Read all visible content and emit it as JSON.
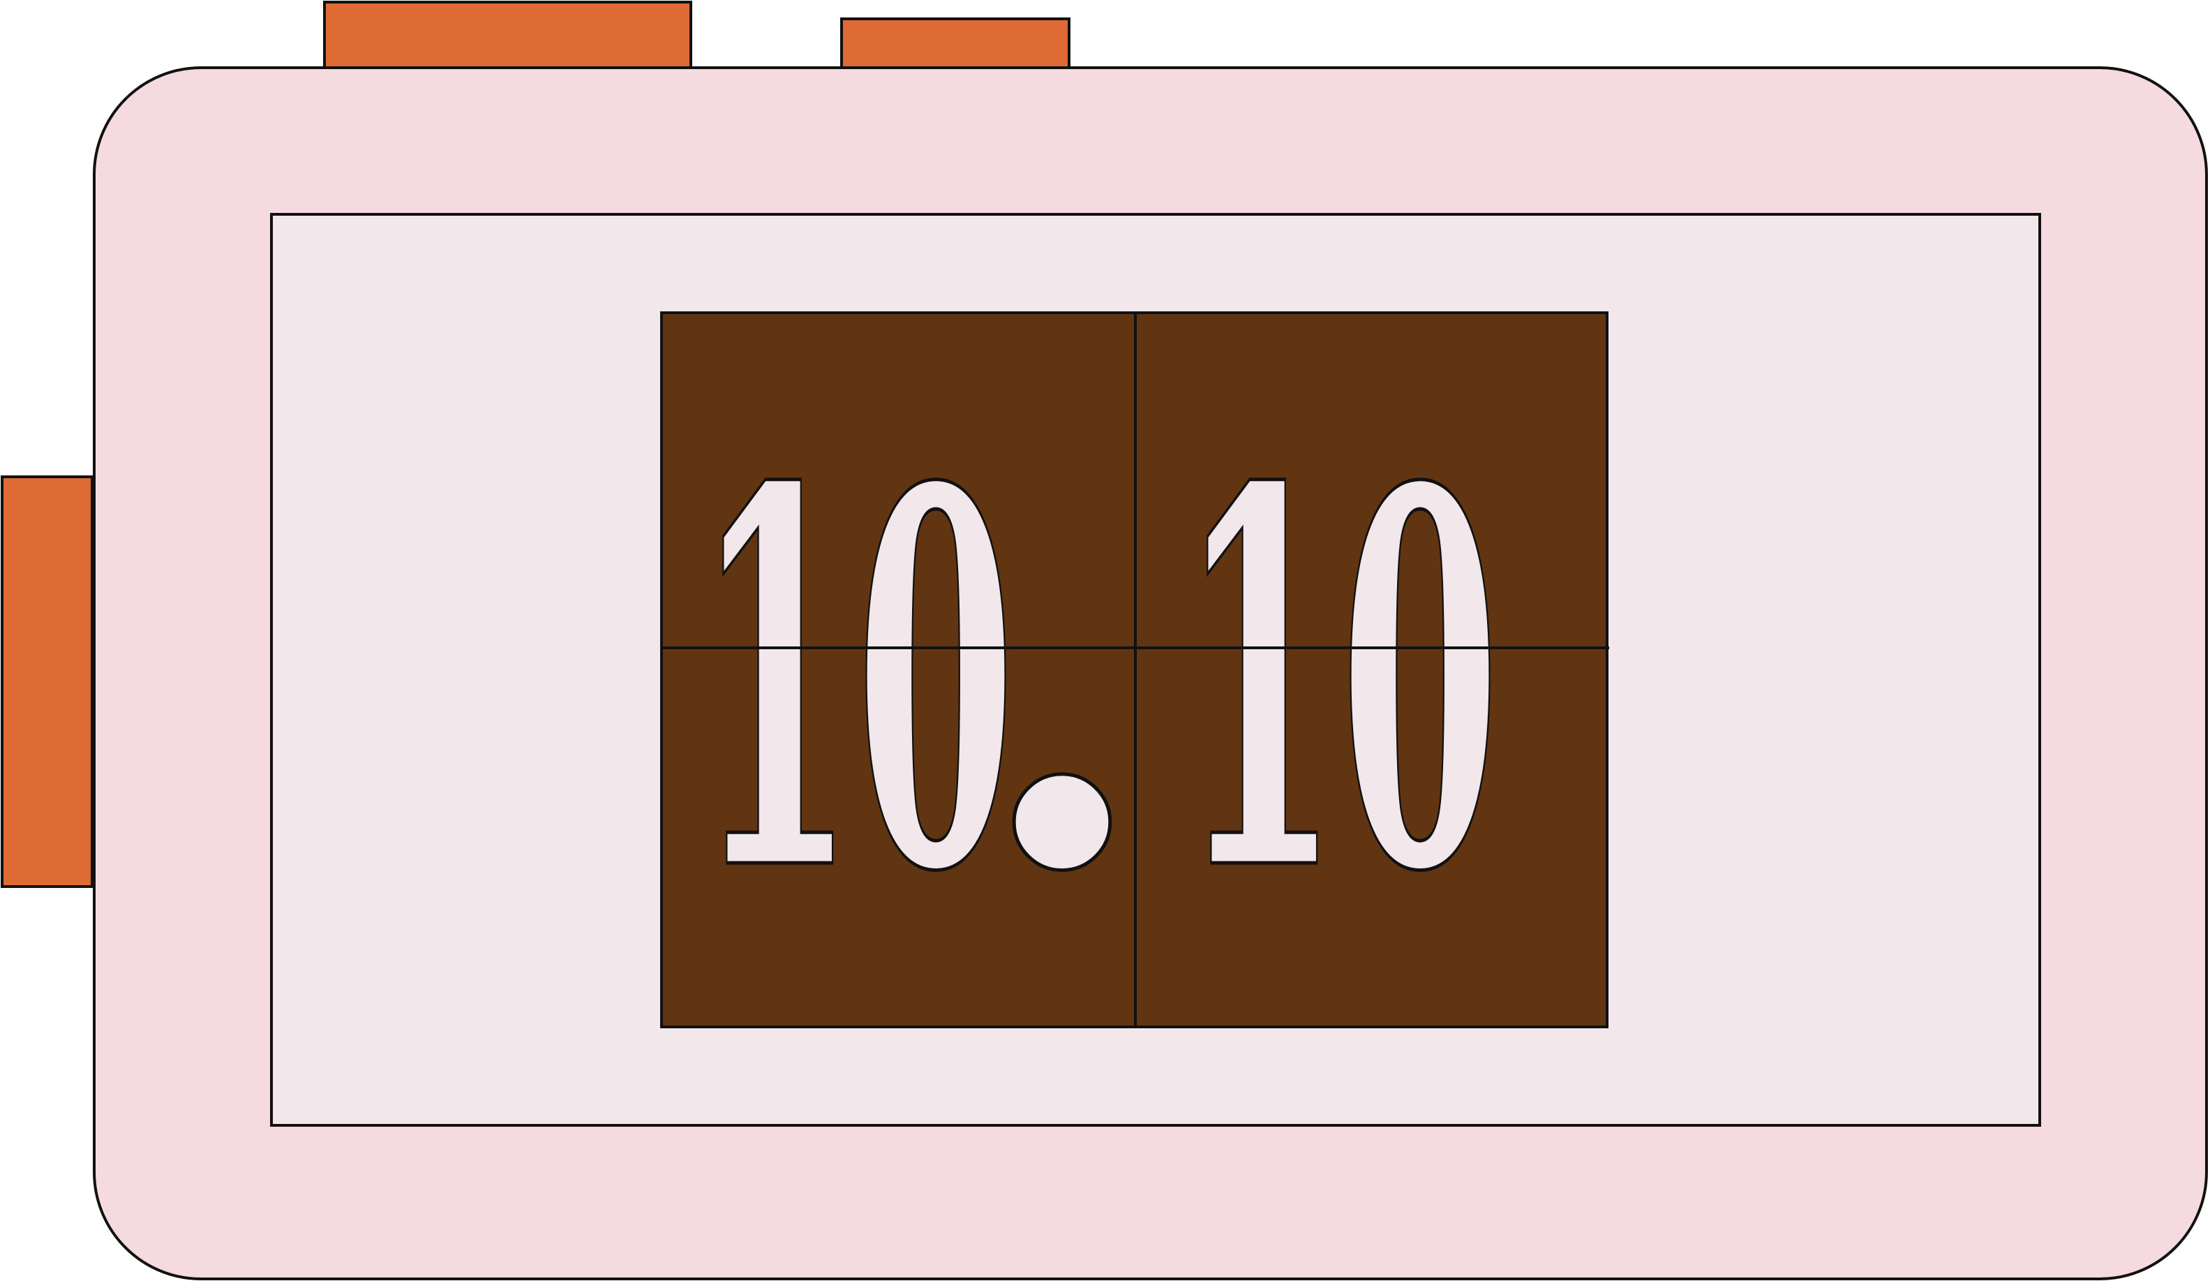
{
  "clock": {
    "time_display": {
      "hours": "10",
      "separator": ".",
      "minutes": "10"
    }
  },
  "colors": {
    "body": "#f5dae0",
    "outline": "#111111",
    "screen_bezel": "#f2e7ea",
    "flip_card": "#613412",
    "digit_fill": "#f2e7ea",
    "button": "#dd6b33",
    "background": "#ffffff"
  },
  "icons": {
    "top_button_left": "button-icon",
    "top_button_right": "button-icon",
    "side_button": "button-icon"
  }
}
